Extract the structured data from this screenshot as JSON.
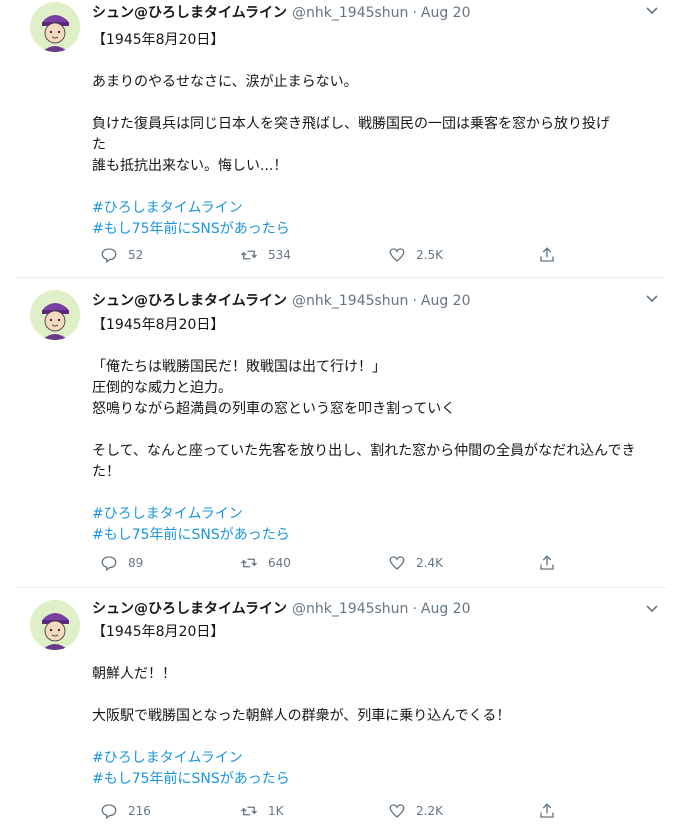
{
  "tweets": [
    {
      "name": "シュン@ひろしまタイムライン",
      "handle": "@nhk_1945shun",
      "separator": "·",
      "time": "Aug 20",
      "date_line": "【1945年8月20日】",
      "body": [
        "あまりのやるせなさに、涙が止まらない。",
        "負けた復員兵は同じ日本人を突き飛ばし、戦勝国民の一団は乗客を窓から放り投げ",
        "た",
        "誰も抵抗出来ない。悔しい...！"
      ],
      "hashtags": [
        "#ひろしまタイムライン",
        "#もし75年前にSNSがあったら"
      ],
      "replies": "52",
      "retweets": "534",
      "likes": "2.5K"
    },
    {
      "name": "シュン@ひろしまタイムライン",
      "handle": "@nhk_1945shun",
      "separator": "·",
      "time": "Aug 20",
      "date_line": "【1945年8月20日】",
      "body": [
        "「俺たちは戦勝国民だ！敗戦国は出て行け！」",
        "圧倒的な威力と迫力。",
        "怒鳴りながら超満員の列車の窓という窓を叩き割っていく",
        "そして、なんと座っていた先客を放り出し、割れた窓から仲間の全員がなだれ込んでき",
        "た！"
      ],
      "hashtags": [
        "#ひろしまタイムライン",
        "#もし75年前にSNSがあったら"
      ],
      "replies": "89",
      "retweets": "640",
      "likes": "2.4K"
    },
    {
      "name": "シュン@ひろしまタイムライン",
      "handle": "@nhk_1945shun",
      "separator": "·",
      "time": "Aug 20",
      "date_line": "【1945年8月20日】",
      "body": [
        "朝鮮人だ！！",
        "大阪駅で戦勝国となった朝鮮人の群衆が、列車に乗り込んでくる！"
      ],
      "hashtags": [
        "#ひろしまタイムライン",
        "#もし75年前にSNSがあったら"
      ],
      "replies": "216",
      "retweets": "1K",
      "likes": "2.2K"
    }
  ],
  "icons": {
    "reply": "reply-icon",
    "retweet": "retweet-icon",
    "like": "heart-icon",
    "share": "share-icon",
    "more": "chevron-down-icon"
  },
  "colors": {
    "hashtag": "#1b95e0",
    "secondary_text": "#657786",
    "divider": "#e6ecf0",
    "avatar_bg": "#dff0c8"
  }
}
